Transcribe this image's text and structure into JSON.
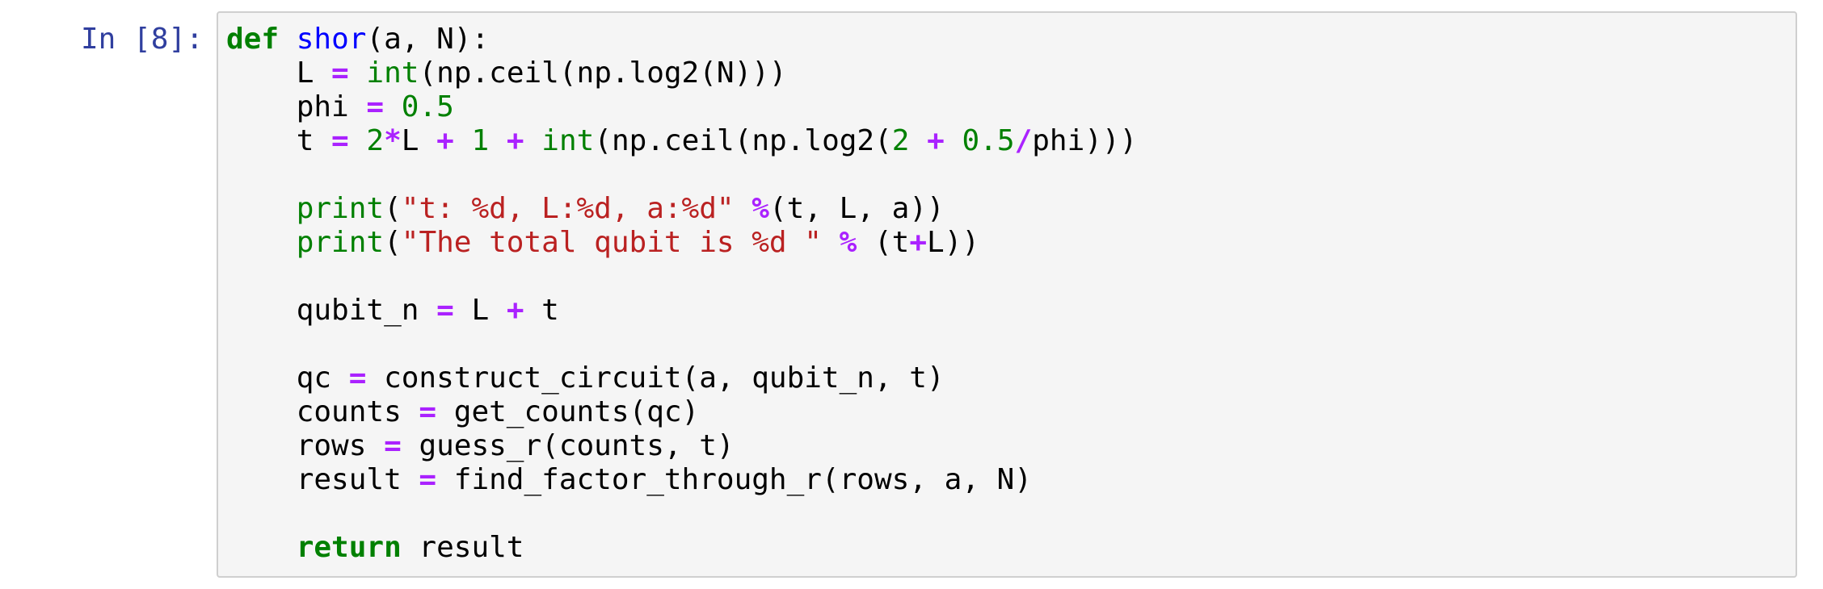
{
  "cell": {
    "prompt": "In [8]:",
    "language": "python"
  },
  "code_lines": [
    [
      {
        "t": "def",
        "c": "k"
      },
      {
        "t": " ",
        "c": "n"
      },
      {
        "t": "shor",
        "c": "nf"
      },
      {
        "t": "(a, N):",
        "c": "p"
      }
    ],
    [
      {
        "t": "    L ",
        "c": "n"
      },
      {
        "t": "=",
        "c": "o"
      },
      {
        "t": " ",
        "c": "n"
      },
      {
        "t": "int",
        "c": "nb"
      },
      {
        "t": "(np.ceil(np.log2(N)))",
        "c": "p"
      }
    ],
    [
      {
        "t": "    phi ",
        "c": "n"
      },
      {
        "t": "=",
        "c": "o"
      },
      {
        "t": " ",
        "c": "n"
      },
      {
        "t": "0.5",
        "c": "m"
      }
    ],
    [
      {
        "t": "    t ",
        "c": "n"
      },
      {
        "t": "=",
        "c": "o"
      },
      {
        "t": " ",
        "c": "n"
      },
      {
        "t": "2",
        "c": "m"
      },
      {
        "t": "*",
        "c": "o"
      },
      {
        "t": "L ",
        "c": "n"
      },
      {
        "t": "+",
        "c": "o"
      },
      {
        "t": " ",
        "c": "n"
      },
      {
        "t": "1",
        "c": "m"
      },
      {
        "t": " ",
        "c": "n"
      },
      {
        "t": "+",
        "c": "o"
      },
      {
        "t": " ",
        "c": "n"
      },
      {
        "t": "int",
        "c": "nb"
      },
      {
        "t": "(np.ceil(np.log2(",
        "c": "p"
      },
      {
        "t": "2",
        "c": "m"
      },
      {
        "t": " ",
        "c": "n"
      },
      {
        "t": "+",
        "c": "o"
      },
      {
        "t": " ",
        "c": "n"
      },
      {
        "t": "0.5",
        "c": "m"
      },
      {
        "t": "/",
        "c": "o"
      },
      {
        "t": "phi)))",
        "c": "p"
      }
    ],
    [],
    [
      {
        "t": "    ",
        "c": "n"
      },
      {
        "t": "print",
        "c": "nb"
      },
      {
        "t": "(",
        "c": "p"
      },
      {
        "t": "\"t: %d, L:%d, a:%d\"",
        "c": "s"
      },
      {
        "t": " ",
        "c": "n"
      },
      {
        "t": "%",
        "c": "o"
      },
      {
        "t": "(t, L, a))",
        "c": "p"
      }
    ],
    [
      {
        "t": "    ",
        "c": "n"
      },
      {
        "t": "print",
        "c": "nb"
      },
      {
        "t": "(",
        "c": "p"
      },
      {
        "t": "\"The total qubit is %d \"",
        "c": "s"
      },
      {
        "t": " ",
        "c": "n"
      },
      {
        "t": "%",
        "c": "o"
      },
      {
        "t": " (t",
        "c": "p"
      },
      {
        "t": "+",
        "c": "o"
      },
      {
        "t": "L))",
        "c": "p"
      }
    ],
    [],
    [
      {
        "t": "    qubit_n ",
        "c": "n"
      },
      {
        "t": "=",
        "c": "o"
      },
      {
        "t": " L ",
        "c": "n"
      },
      {
        "t": "+",
        "c": "o"
      },
      {
        "t": " t",
        "c": "n"
      }
    ],
    [],
    [
      {
        "t": "    qc ",
        "c": "n"
      },
      {
        "t": "=",
        "c": "o"
      },
      {
        "t": " construct_circuit(a, qubit_n, t)",
        "c": "n"
      }
    ],
    [
      {
        "t": "    counts ",
        "c": "n"
      },
      {
        "t": "=",
        "c": "o"
      },
      {
        "t": " get_counts(qc)",
        "c": "n"
      }
    ],
    [
      {
        "t": "    rows ",
        "c": "n"
      },
      {
        "t": "=",
        "c": "o"
      },
      {
        "t": " guess_r(counts, t)",
        "c": "n"
      }
    ],
    [
      {
        "t": "    result ",
        "c": "n"
      },
      {
        "t": "=",
        "c": "o"
      },
      {
        "t": " find_factor_through_r(rows, a, N)",
        "c": "n"
      }
    ],
    [],
    [
      {
        "t": "    ",
        "c": "n"
      },
      {
        "t": "return",
        "c": "k"
      },
      {
        "t": " result",
        "c": "n"
      }
    ]
  ]
}
